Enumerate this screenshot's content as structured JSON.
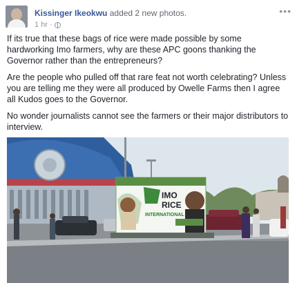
{
  "post": {
    "author": "Kissinger Ikeokwu",
    "action": "added 2 new photos.",
    "time": "1 hr",
    "separator": "·",
    "more_icon": "ellipsis-icon",
    "paragraphs": [
      "If its true that these bags of rice were made possible by some hardworking Imo farmers, why are these APC goons thanking the Governor rather than the entrepreneurs?",
      "Are the people who pulled off that rare feat not worth celebrating? Unless you are telling me they were all produced by Owelle Farms then I agree all Kudos goes to the Governor.",
      "No wonder journalists cannot see the farmers or their major distributors to interview."
    ]
  },
  "photo": {
    "banner_title_line1": "IMO",
    "banner_title_line2": "RICE",
    "banner_subtitle": "INTERNATIONAL"
  }
}
